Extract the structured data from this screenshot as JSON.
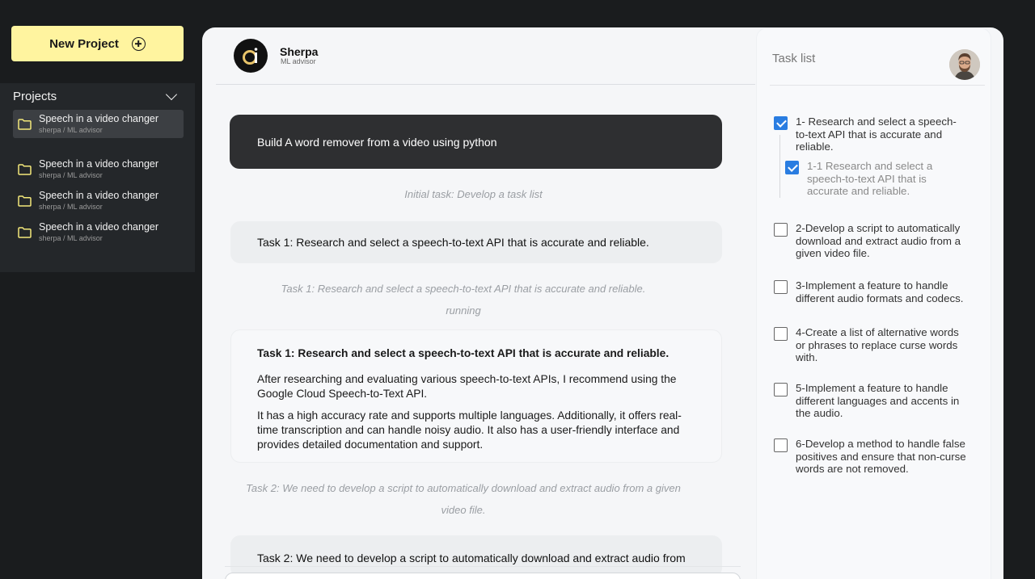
{
  "sidebar": {
    "new_project_label": "New Project",
    "projects_label": "Projects",
    "projects": [
      {
        "title": "Speech in a video changer",
        "subtitle": "sherpa / ML advisor"
      },
      {
        "title": "Speech in a video changer",
        "subtitle": "sherpa / ML advisor"
      },
      {
        "title": "Speech in a video changer",
        "subtitle": "sherpa / ML advisor"
      },
      {
        "title": "Speech in a video changer",
        "subtitle": "sherpa / ML advisor"
      }
    ]
  },
  "chat": {
    "agent_name": "Sherpa",
    "agent_role": "ML advisor",
    "user_message": "Build A word remover from a video using python",
    "note_initial": "Initial task: Develop a task list",
    "task1_card": "Task 1: Research and select a speech-to-text API that is accurate and reliable.",
    "task1_note": "Task 1: Research and select a speech-to-text API that is accurate and reliable.",
    "task1_status": "running",
    "result": {
      "title": "Task 1: Research and select a speech-to-text API that is accurate and reliable.",
      "p1": "After researching and evaluating various speech-to-text APIs, I recommend using the Google Cloud Speech-to-Text API.",
      "p2": "It has a high accuracy rate and supports multiple languages. Additionally, it offers real-time transcription and can handle noisy audio. It also has a user-friendly interface and provides detailed documentation and support."
    },
    "task2_note_line1": "Task 2: We need to develop a script to automatically download and extract audio from a given",
    "task2_note_line2": "video file.",
    "task2_card": "Task 2: We need to develop a script to automatically download and extract audio from"
  },
  "task_list": {
    "title": "Task list",
    "items": [
      {
        "text": "1- Research and select a speech-to-text API that is accurate and reliable.",
        "checked": true
      },
      {
        "text": "1-1 Research and select a speech-to-text API that is accurate and reliable.",
        "checked": true
      },
      {
        "text": "2-Develop a script to automatically download and extract audio from a given video file.",
        "checked": false
      },
      {
        "text": "3-Implement a feature to handle different audio formats and codecs.",
        "checked": false
      },
      {
        "text": "4-Create a list of alternative words or phrases to replace curse words with.",
        "checked": false
      },
      {
        "text": "5-Implement a feature to handle different languages and accents in the audio.",
        "checked": false
      },
      {
        "text": "6-Develop a method to handle false positives and ensure that non-curse words are not removed.",
        "checked": false
      }
    ]
  },
  "colors": {
    "accent_yellow": "#fff49f",
    "checkbox_blue": "#2a7de1",
    "background": "#1a1c1e"
  }
}
